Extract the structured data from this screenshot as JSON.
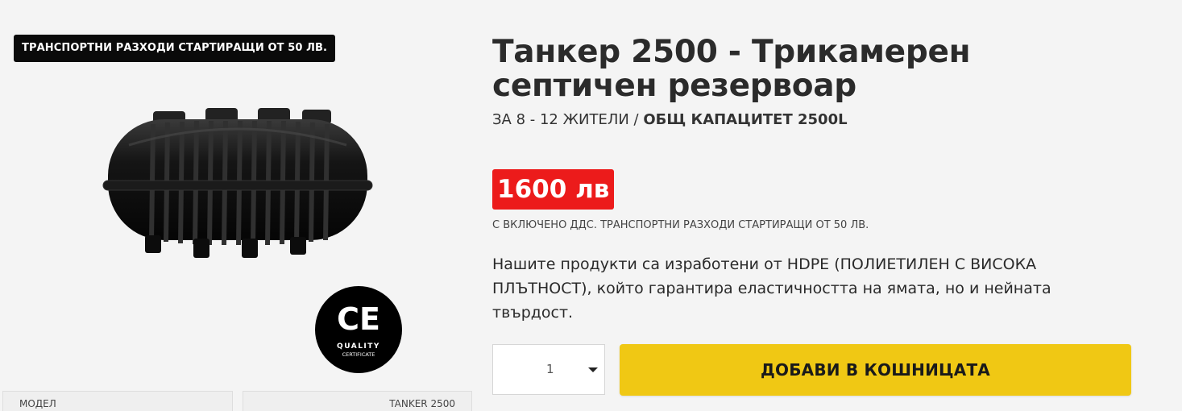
{
  "badges": {
    "shipping": "ТРАНСПОРТНИ РАЗХОДИ СТАРТИРАЩИ ОТ 50 ЛВ."
  },
  "product": {
    "title": "Танкер 2500 - Трикамерен септичен резервоар",
    "subtitle_regular": "ЗА 8 - 12 ЖИТЕЛИ / ",
    "subtitle_bold": "ОБЩ КАПАЦИТЕТ 2500L",
    "price": "1600 лв",
    "vat_note": "С ВКЛЮЧЕНО ДДС. ТРАНСПОРТНИ РАЗХОДИ СТАРТИРАЩИ ОТ 50 ЛВ.",
    "description": "Нашите продукти са изработени от HDPE (ПОЛИЕТИЛЕН С ВИСОКА ПЛЪТНОСТ), който гарантира еластичността на ямата, но и нейната твърдост.",
    "image_icon": "septic-tank-image",
    "certificate": {
      "mark": "CE",
      "line1": "QUALITY",
      "line2": "CERTIFICATE"
    }
  },
  "specs": {
    "label": "МОДЕЛ",
    "value": "TANKER 2500"
  },
  "cart": {
    "quantity": "1",
    "add_button": "ДОБАВИ В КОШНИЦАТА"
  },
  "colors": {
    "price_bg": "#ec1b1b",
    "button_bg": "#f0c814",
    "badge_bg": "#0a0a0a",
    "page_bg": "#f4f4f4"
  }
}
